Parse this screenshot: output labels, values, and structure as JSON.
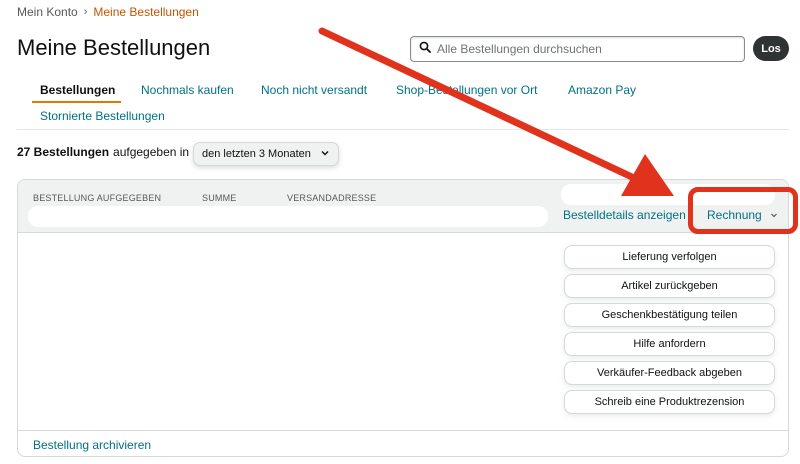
{
  "breadcrumb": {
    "parent": "Mein Konto",
    "separator": "›",
    "current": "Meine Bestellungen"
  },
  "page_title": "Meine Bestellungen",
  "search": {
    "placeholder": "Alle Bestellungen durchsuchen",
    "value": "",
    "button_label": "Los",
    "icon": "search-icon"
  },
  "tabs": [
    {
      "label": "Bestellungen",
      "active": true
    },
    {
      "label": "Nochmals kaufen",
      "active": false
    },
    {
      "label": "Noch nicht versandt",
      "active": false
    },
    {
      "label": "Shop-Bestellungen vor Ort",
      "active": false
    },
    {
      "label": "Amazon Pay",
      "active": false
    },
    {
      "label": "Stornierte Bestellungen",
      "active": false
    }
  ],
  "filter": {
    "count_label": "27 Bestellungen",
    "text": "aufgegeben in",
    "selected": "den letzten 3 Monaten"
  },
  "order": {
    "columns": [
      "BESTELLUNG AUFGEGEBEN",
      "SUMME",
      "VERSANDADRESSE"
    ],
    "details_link": "Bestelldetails anzeigen",
    "invoice_label": "Rechnung",
    "actions": [
      "Lieferung verfolgen",
      "Artikel zurückgeben",
      "Geschenkbestätigung teilen",
      "Hilfe anfordern",
      "Verkäufer-Feedback abgeben",
      "Schreib eine Produktrezension"
    ],
    "archive_link": "Bestellung archivieren"
  },
  "colors": {
    "link": "#007185",
    "breadcrumb_current": "#c45500",
    "tab_underline": "#e77600",
    "annotation": "#e0321c"
  }
}
